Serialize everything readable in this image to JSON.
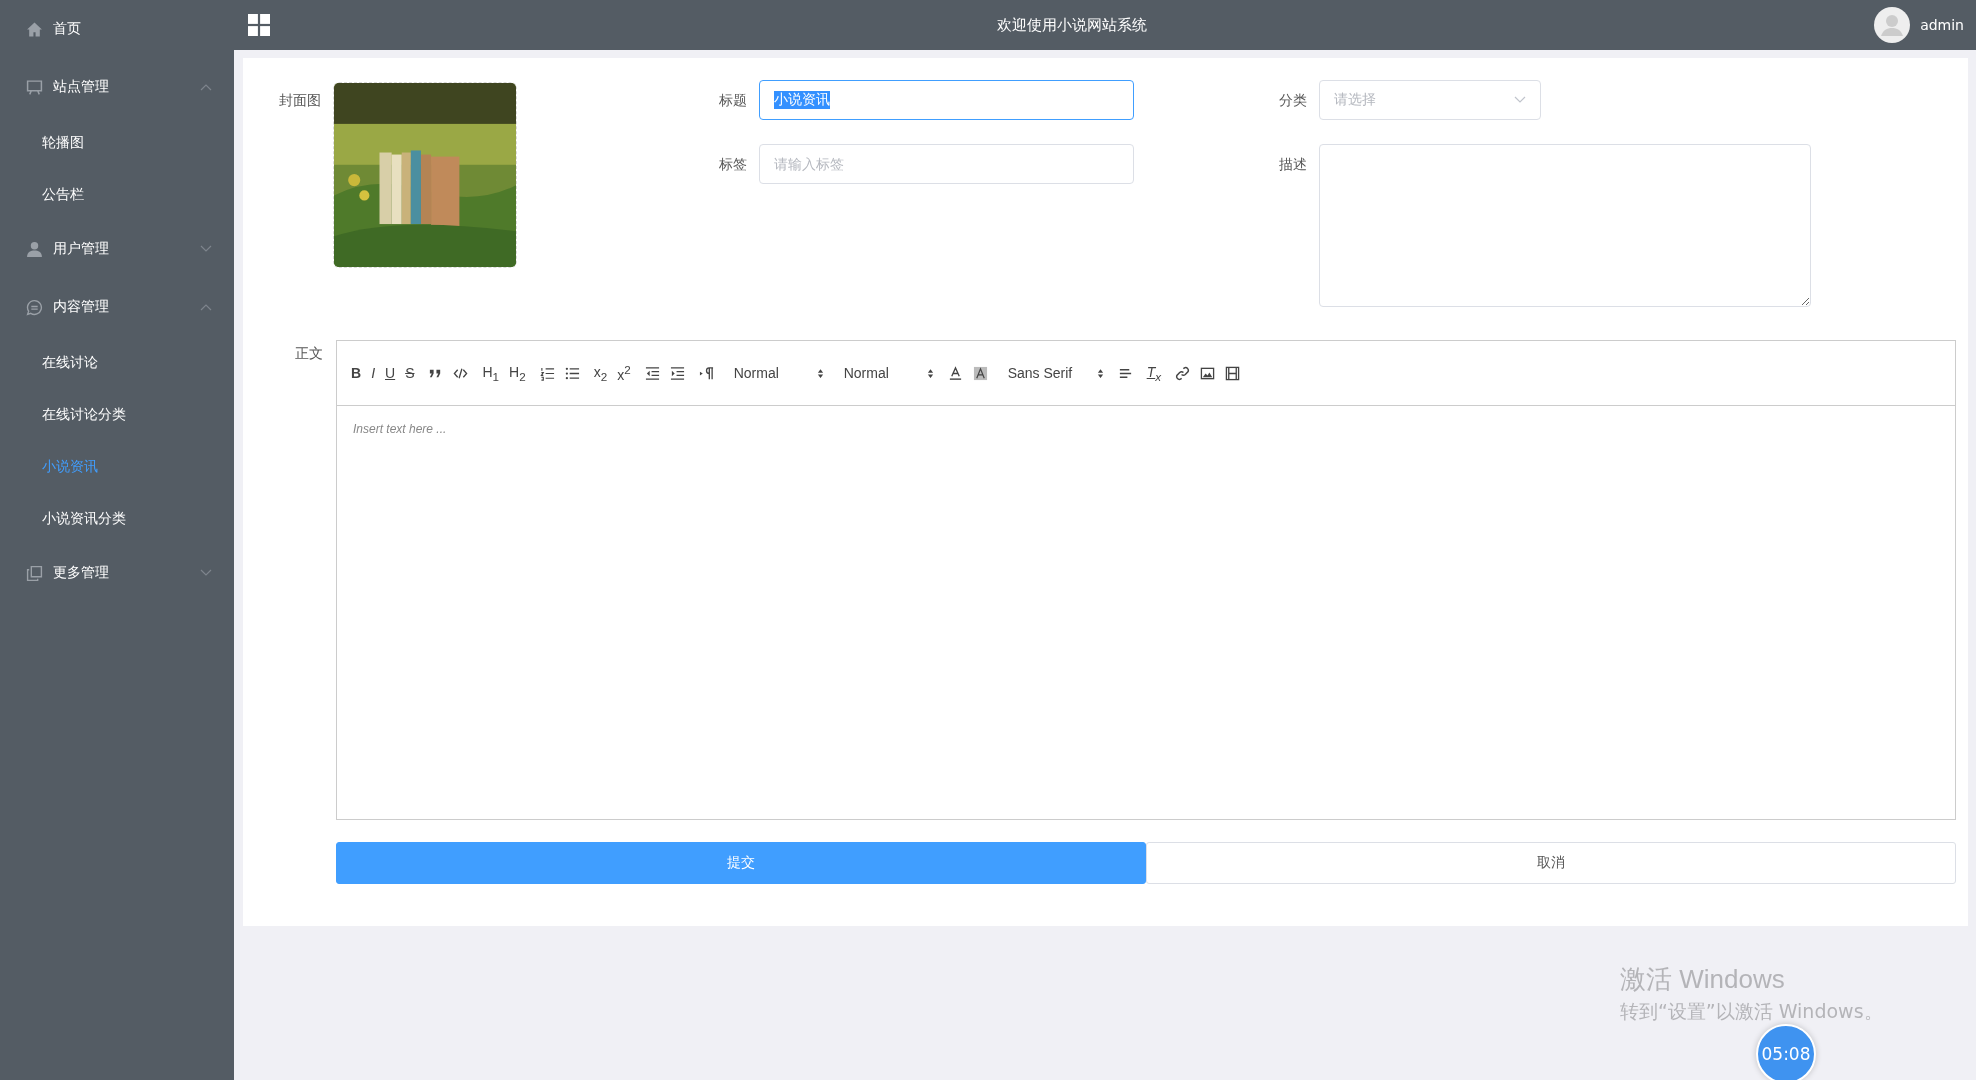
{
  "sidebar": {
    "items": [
      {
        "kind": "link",
        "label": "首页"
      },
      {
        "kind": "group",
        "label": "站点管理",
        "expanded": true,
        "children": [
          {
            "label": "轮播图",
            "selected": false
          },
          {
            "label": "公告栏",
            "selected": false
          }
        ]
      },
      {
        "kind": "group",
        "label": "用户管理",
        "expanded": false
      },
      {
        "kind": "group",
        "label": "内容管理",
        "expanded": true,
        "children": [
          {
            "label": "在线讨论",
            "selected": false
          },
          {
            "label": "在线讨论分类",
            "selected": false
          },
          {
            "label": "小说资讯",
            "selected": true
          },
          {
            "label": "小说资讯分类",
            "selected": false
          }
        ]
      },
      {
        "kind": "group",
        "label": "更多管理",
        "expanded": false
      }
    ]
  },
  "header": {
    "title": "欢迎使用小说网站系统",
    "user": "admin"
  },
  "form": {
    "cover": {
      "label": "封面图"
    },
    "title": {
      "label": "标题",
      "value": "小说资讯",
      "text_selected": true
    },
    "tags": {
      "label": "标签",
      "placeholder": "请输入标签"
    },
    "category": {
      "label": "分类",
      "placeholder": "请选择"
    },
    "description": {
      "label": "描述"
    },
    "body": {
      "label": "正文",
      "placeholder": "Insert text here ..."
    },
    "toolbar": {
      "format_buttons": [
        "B",
        "I",
        "U",
        "S"
      ],
      "headers": [
        "H$_{1}$",
        "H$_{2}$"
      ],
      "scripts": [
        "x$_{2}$",
        "x$^{2}$"
      ],
      "pickers": [
        "Normal",
        "Normal",
        "Sans Serif"
      ],
      "clear": "T$_{x}$"
    },
    "buttons": [
      {
        "kind": "primary",
        "label": "提交"
      },
      {
        "kind": "default",
        "label": "取消"
      }
    ]
  },
  "overlay": {
    "activation_title": "激活 Windows",
    "activation_hint": "转到“设置”以激活 Windows。",
    "timer": "05:08"
  }
}
